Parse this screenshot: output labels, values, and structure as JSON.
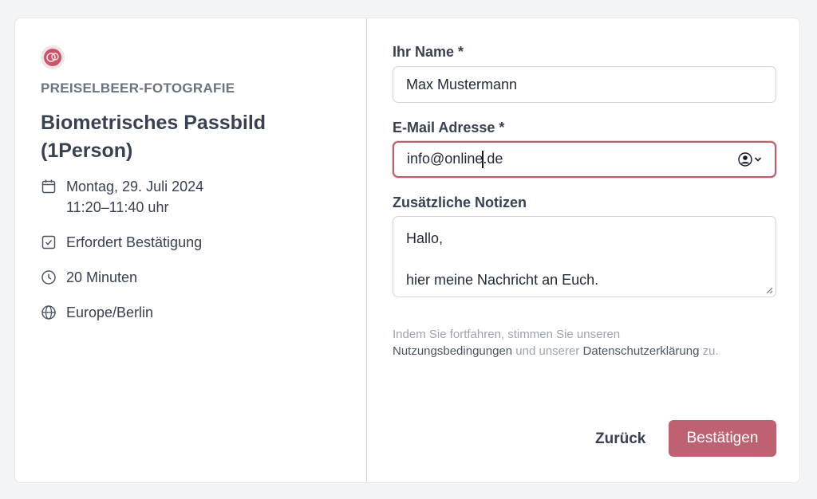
{
  "event": {
    "brand": "PREISELBEER-FOTOGRAFIE",
    "title": "Biometrisches Passbild (1Person)",
    "date": "Montag, 29. Juli 2024",
    "time": "11:20–11:40 uhr",
    "confirmation": "Erfordert Bestätigung",
    "duration": "20 Minuten",
    "timezone": "Europe/Berlin"
  },
  "form": {
    "name_label": "Ihr Name *",
    "name_value": "Max Mustermann",
    "email_label": "E-Mail Adresse *",
    "email_value_before_caret": "info@online",
    "email_value_after_caret": ".de",
    "notes_label": "Zusätzliche Notizen",
    "notes_line1": "Hallo,",
    "notes_line2": "hier meine Nachricht an Euch."
  },
  "legal": {
    "text_1": "Indem Sie fortfahren, stimmen Sie unseren",
    "terms_link": "Nutzungsbedingungen",
    "text_2": " und unserer ",
    "privacy_link": "Datenschutzerklärung",
    "text_3": " zu."
  },
  "actions": {
    "back_label": "Zurück",
    "confirm_label": "Bestätigen"
  },
  "colors": {
    "accent": "#be6272",
    "focus_border": "#b85c6e"
  }
}
